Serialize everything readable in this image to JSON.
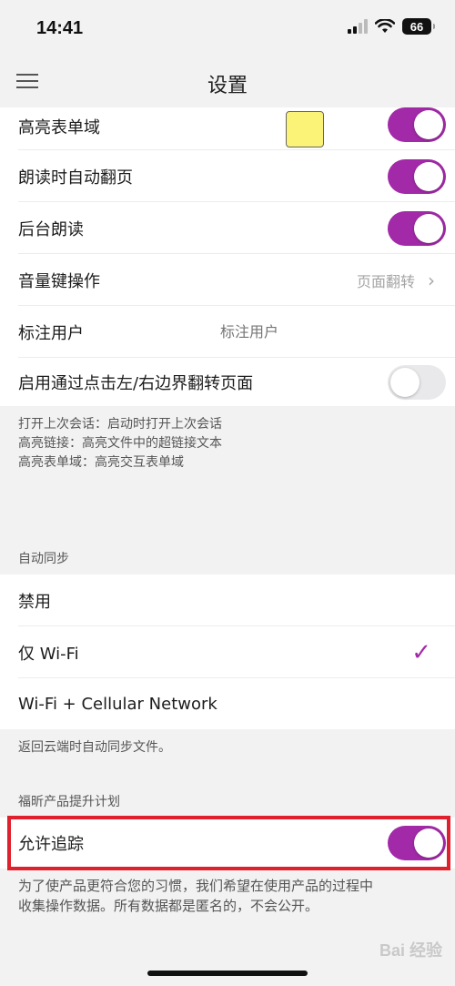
{
  "status_bar": {
    "time": "14:41",
    "battery": "66"
  },
  "header": {
    "title": "设置"
  },
  "settings": {
    "highlight_form_field": {
      "label": "高亮表单域",
      "swatch_color": "#fbf377",
      "enabled": true
    },
    "auto_turn_page_reading": {
      "label": "朗读时自动翻页",
      "enabled": true
    },
    "background_reading": {
      "label": "后台朗读",
      "enabled": true
    },
    "volume_key_action": {
      "label": "音量键操作",
      "value": "页面翻转"
    },
    "annotation_user": {
      "label": "标注用户",
      "placeholder": "标注用户"
    },
    "tap_edge_flip": {
      "label": "启用通过点击左/右边界翻转页面",
      "enabled": false
    }
  },
  "footnotes": {
    "lines": [
      "打开上次会话：启动时打开上次会话",
      "高亮链接：高亮文件中的超链接文本",
      "高亮表单域：高亮交互表单域"
    ]
  },
  "auto_sync": {
    "header": "自动同步",
    "options": [
      "禁用",
      "仅 Wi-Fi",
      "Wi-Fi + Cellular Network"
    ],
    "selected": "仅 Wi-Fi",
    "footnote": "返回云端时自动同步文件。"
  },
  "improvement_program": {
    "header": "福昕产品提升计划",
    "allow_tracking": {
      "label": "允许追踪",
      "enabled": true
    },
    "description_lines": [
      "为了使产品更符合您的习惯，我们希望在使用产品的过程中",
      "收集操作数据。所有数据都是匿名的，不会公开。"
    ]
  },
  "watermark": "Bai 经验",
  "colors": {
    "accent": "#a22aa8",
    "highlight_box": "#e0202c"
  }
}
